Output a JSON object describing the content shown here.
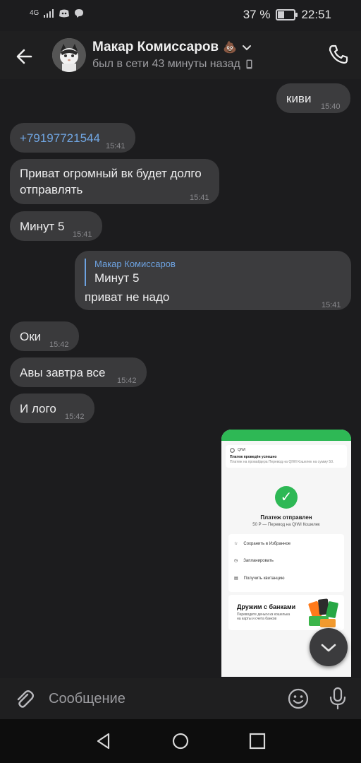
{
  "status": {
    "network": "4G",
    "battery": "37 %",
    "time": "22:51"
  },
  "header": {
    "name": "Макар Комиссаров",
    "emoji": "💩",
    "last_seen": "был в сети 43 минуты назад"
  },
  "messages": [
    {
      "text": "киви",
      "time": "15:40",
      "dir": "out"
    },
    {
      "text": "+79197721544",
      "time": "15:41",
      "dir": "in"
    },
    {
      "text_line1": "Приват огромный вк будет долго",
      "text_line2": "отправлять",
      "time": "15:41",
      "dir": "in"
    },
    {
      "text": "Минут 5",
      "time": "15:41",
      "dir": "in"
    },
    {
      "reply_name": "Макар Комиссаров",
      "reply_text": "Минут 5",
      "text": "приват не надо",
      "time": "15:41",
      "dir": "out"
    },
    {
      "text": "Оки",
      "time": "15:42",
      "dir": "in"
    },
    {
      "text": "Авы завтра все",
      "time": "15:42",
      "dir": "in"
    },
    {
      "text": "И лого",
      "time": "15:42",
      "dir": "in"
    }
  ],
  "image": {
    "app": "QIWI",
    "notice_title": "Платеж проведён успешно",
    "notice_text": "Платеж на провайдера Перевод на QIWI Кошелек на сумму 50.",
    "status_title": "Платеж отправлен",
    "status_sub": "50 Р — Перевод на QIWI Кошелек",
    "menu": [
      "Сохранить в Избранное",
      "Запланировать",
      "Получить квитанцию"
    ],
    "banks_title": "Дружим с банками",
    "banks_text": "Переводите деньги из кошелька на карты и счета банков"
  },
  "input": {
    "placeholder": "Сообщение"
  }
}
